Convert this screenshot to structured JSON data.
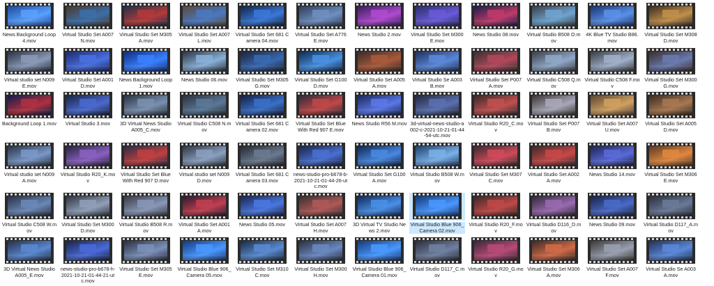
{
  "files": {
    "items": [
      {
        "name": "News Background Loop 4.mov",
        "c1": "#1d4a9a",
        "c2": "#5aa0ff"
      },
      {
        "name": "Virtual Studio Set A007 N.mov",
        "c1": "#4a3a2e",
        "c2": "#3b6ea8"
      },
      {
        "name": "Virtual Studio Set M305 A.mov",
        "c1": "#24314a",
        "c2": "#b23a3a"
      },
      {
        "name": "Virtual Studio Set A007 L.mov",
        "c1": "#5b4a3a",
        "c2": "#4a78c0"
      },
      {
        "name": "Virtual Studio Set 681 Camera 04.mov",
        "c1": "#142545",
        "c2": "#3a78d8"
      },
      {
        "name": "Virtual Studio Set A776 E.mov",
        "c1": "#2f3d58",
        "c2": "#6f8fc0"
      },
      {
        "name": "News Studio 2.mov",
        "c1": "#3a1e5c",
        "c2": "#b04ad0"
      },
      {
        "name": "Virtual Studio Set M300 E.mov",
        "c1": "#2a2e6a",
        "c2": "#6a5ad8"
      },
      {
        "name": "News Studio 08.mov",
        "c1": "#1b1f4a",
        "c2": "#c03a6a"
      },
      {
        "name": "Virtual Studio B508 O.mov",
        "c1": "#3c3f48",
        "c2": "#6fa4d0"
      },
      {
        "name": "4K Blue TV Studio B86.mov",
        "c1": "#1a3570",
        "c2": "#5a90e8"
      },
      {
        "name": "Virtual Studio Set M308 D.mov",
        "c1": "#3d2c22",
        "c2": "#c0904a"
      },
      {
        "name": "Virtual studio set N009 E.mov",
        "c1": "#2a3140",
        "c2": "#8a9ab8"
      },
      {
        "name": "Virtual Studio Set A001 D.mov",
        "c1": "#1d2a6a",
        "c2": "#4a70e0"
      },
      {
        "name": "News Background Loop 1.mov",
        "c1": "#0f2e7a",
        "c2": "#3a80ff"
      },
      {
        "name": "News Studio 06.mov",
        "c1": "#2b3340",
        "c2": "#8ab0d8"
      },
      {
        "name": "Virtual Studio Set M305 G.mov",
        "c1": "#1a2438",
        "c2": "#3a68b0"
      },
      {
        "name": "Virtual Studio Set G100 D.mov",
        "c1": "#0e2a50",
        "c2": "#4a90e0"
      },
      {
        "name": "Virtual Studio Set A005 A.mov",
        "c1": "#3a2a28",
        "c2": "#a85a3a"
      },
      {
        "name": "Virtual Studio Se A003 B.mov",
        "c1": "#20305a",
        "c2": "#5a88d8"
      },
      {
        "name": "Virtual Studio Set P007 A.mov",
        "c1": "#3a3030",
        "c2": "#b0485a"
      },
      {
        "name": "Virtual Studio C508 Q.mov",
        "c1": "#3a3d44",
        "c2": "#90a8c8"
      },
      {
        "name": "Virtual Studio C508 F.mov",
        "c1": "#383c44",
        "c2": "#a0b0c8"
      },
      {
        "name": "Virtual Studio Set M300 G.mov",
        "c1": "#3a2e2a",
        "c2": "#6a7ab0"
      },
      {
        "name": "Background Loop 1.mov",
        "c1": "#101c48",
        "c2": "#b03040"
      },
      {
        "name": "Virtual Studio 3.mov",
        "c1": "#1a2440",
        "c2": "#4a6ad0"
      },
      {
        "name": "3D Virtual News Studio A005_C.mov",
        "c1": "#2a3340",
        "c2": "#7a90b0"
      },
      {
        "name": "Virtual Studio C508 N.mov",
        "c1": "#2c3038",
        "c2": "#5a7898"
      },
      {
        "name": "Virtual Studio Set 681 Camera 02.mov",
        "c1": "#142040",
        "c2": "#3a70c8"
      },
      {
        "name": "Virtual Studio Set Blue With Red 907 E.mov",
        "c1": "#302a3a",
        "c2": "#c04848"
      },
      {
        "name": "News Studio R56 M.mov",
        "c1": "#1a2658",
        "c2": "#5a78e8"
      },
      {
        "name": "3d-virtual-news-studio-a002-c-2021-10-21-01-44-54-utc.mov",
        "c1": "#24283a",
        "c2": "#5a70b0"
      },
      {
        "name": "Virtual Studio R20_C.mov",
        "c1": "#3a2828",
        "c2": "#c05050"
      },
      {
        "name": "Virtual Studio Set P007 B.mov",
        "c1": "#3a3434",
        "c2": "#a8a8b8"
      },
      {
        "name": "Virtual Studio Set A007 U.mov",
        "c1": "#5a4634",
        "c2": "#d0a060"
      },
      {
        "name": "Virtual Studio Set A005 D.mov",
        "c1": "#3a2c24",
        "c2": "#a87850"
      },
      {
        "name": "Virtual studio set N009 A.mov",
        "c1": "#2a3244",
        "c2": "#7a98c8"
      },
      {
        "name": "Virtual Studio R20_K.mov",
        "c1": "#2a2440",
        "c2": "#8a60c0"
      },
      {
        "name": "Virtual Studio Set Blue With Red 907 D.mov",
        "c1": "#2a2c44",
        "c2": "#c04040"
      },
      {
        "name": "Virtual studio set N009 D.mov",
        "c1": "#303642",
        "c2": "#8aa0c0"
      },
      {
        "name": "Virtual Studio Set 681 Camera 03.mov",
        "c1": "#262a30",
        "c2": "#6a7a90"
      },
      {
        "name": "news-studio-pro-b678-b-2021-10-21-01-44-26-utc.mov",
        "c1": "#1a2448",
        "c2": "#4a70d0"
      },
      {
        "name": "Virtual Studio Set G100 A.mov",
        "c1": "#0e2850",
        "c2": "#4a88e0"
      },
      {
        "name": "Virtual Studio B508 W.mov",
        "c1": "#20406a",
        "c2": "#7ab0e8"
      },
      {
        "name": "Virtual Studio Set M307 C.mov",
        "c1": "#3a2a30",
        "c2": "#d04a5a"
      },
      {
        "name": "Virtual Studio Set A002 A.mov",
        "c1": "#3a2a2a",
        "c2": "#c84848"
      },
      {
        "name": "News Studio 14.mov",
        "c1": "#1e2450",
        "c2": "#5a6ad8"
      },
      {
        "name": "Virtual Studio Set M306 E.mov",
        "c1": "#5a3a22",
        "c2": "#e08840"
      },
      {
        "name": "Virtual Studio C508 W.mov",
        "c1": "#2a3040",
        "c2": "#6a88b8"
      },
      {
        "name": "Virtual Studio Set M300 D.mov",
        "c1": "#303540",
        "c2": "#90a0b8"
      },
      {
        "name": "Virtual Studio B508 R.mov",
        "c1": "#3a3a44",
        "c2": "#8898b8"
      },
      {
        "name": "Virtual Studio Set A001 A.mov",
        "c1": "#2a1a30",
        "c2": "#c04050"
      },
      {
        "name": "News Studio 05.mov",
        "c1": "#1a2450",
        "c2": "#4a78e0"
      },
      {
        "name": "Virtual Studio Set A007 H.mov",
        "c1": "#3a3030",
        "c2": "#b05858"
      },
      {
        "name": "3D Virtual TV Studio News 2.mov",
        "c1": "#102a58",
        "c2": "#4a90e8"
      },
      {
        "name": "Virtual Studio Blue 906_Camera 02.mov",
        "c1": "#143a78",
        "c2": "#4a98ff"
      },
      {
        "name": "Virtual Studio R20_F.mov",
        "c1": "#3a2828",
        "c2": "#c04848"
      },
      {
        "name": "Virtual Studio D116_D.mov",
        "c1": "#302838",
        "c2": "#9a6ab0"
      },
      {
        "name": "News Studio 09.mov",
        "c1": "#1a2244",
        "c2": "#4a6ac8"
      },
      {
        "name": "Virtual Studio D117_A.mov",
        "c1": "#2a2e3a",
        "c2": "#6a7a98"
      },
      {
        "name": "3D Virtual News Studio A005_E.mov",
        "c1": "#24304a",
        "c2": "#5a88d0"
      },
      {
        "name": "news-studio-pro-b678-h-2021-10-21-01-44-21-utc.mov",
        "c1": "#1a2448",
        "c2": "#4a6ad8"
      },
      {
        "name": "Virtual Studio Set M305 E.mov",
        "c1": "#2a3040",
        "c2": "#7a90b8"
      },
      {
        "name": "Virtual Studio Blue 906_Camera 05.mov",
        "c1": "#143a78",
        "c2": "#4a98ff"
      },
      {
        "name": "Virtual Studio Set M310 C.mov",
        "c1": "#1a2a40",
        "c2": "#5a8ad0"
      },
      {
        "name": "Virtual Studio Set M300 H.mov",
        "c1": "#283040",
        "c2": "#6a88c0"
      },
      {
        "name": "Virtual Studio Blue 906_Camera 01.mov",
        "c1": "#143a78",
        "c2": "#4a98ff"
      },
      {
        "name": "Virtual Studio D117_C.mov",
        "c1": "#2a2e3a",
        "c2": "#7080a0"
      },
      {
        "name": "Virtual Studio R20_G.mov",
        "c1": "#3a2838",
        "c2": "#b84a78"
      },
      {
        "name": "Virtual Studio Set M306 A.mov",
        "c1": "#3a2a24",
        "c2": "#d06a48"
      },
      {
        "name": "Virtual Studio Set A007 F.mov",
        "c1": "#3a3838",
        "c2": "#9aa0b0"
      },
      {
        "name": "Virtual Studio Se A003 A.mov",
        "c1": "#20305a",
        "c2": "#5a88d8"
      }
    ],
    "selected_index": 55
  }
}
